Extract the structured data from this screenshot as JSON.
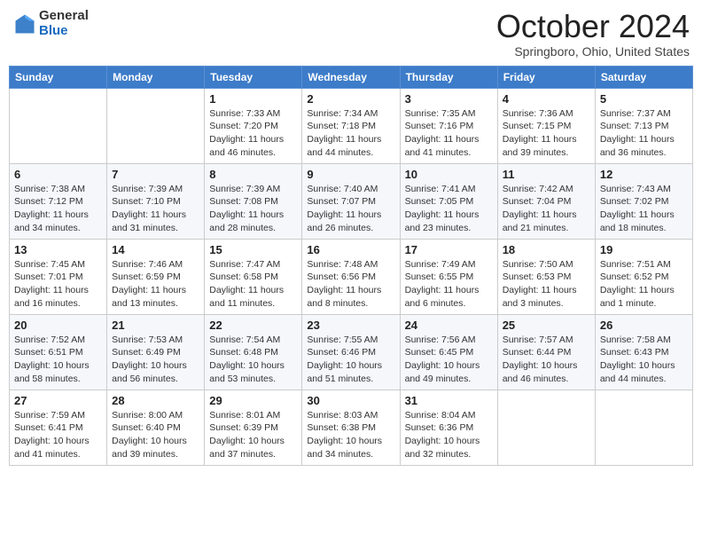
{
  "header": {
    "logo_general": "General",
    "logo_blue": "Blue",
    "month": "October 2024",
    "location": "Springboro, Ohio, United States"
  },
  "weekdays": [
    "Sunday",
    "Monday",
    "Tuesday",
    "Wednesday",
    "Thursday",
    "Friday",
    "Saturday"
  ],
  "weeks": [
    [
      {
        "day": null
      },
      {
        "day": null
      },
      {
        "day": "1",
        "sunrise": "Sunrise: 7:33 AM",
        "sunset": "Sunset: 7:20 PM",
        "daylight": "Daylight: 11 hours and 46 minutes."
      },
      {
        "day": "2",
        "sunrise": "Sunrise: 7:34 AM",
        "sunset": "Sunset: 7:18 PM",
        "daylight": "Daylight: 11 hours and 44 minutes."
      },
      {
        "day": "3",
        "sunrise": "Sunrise: 7:35 AM",
        "sunset": "Sunset: 7:16 PM",
        "daylight": "Daylight: 11 hours and 41 minutes."
      },
      {
        "day": "4",
        "sunrise": "Sunrise: 7:36 AM",
        "sunset": "Sunset: 7:15 PM",
        "daylight": "Daylight: 11 hours and 39 minutes."
      },
      {
        "day": "5",
        "sunrise": "Sunrise: 7:37 AM",
        "sunset": "Sunset: 7:13 PM",
        "daylight": "Daylight: 11 hours and 36 minutes."
      }
    ],
    [
      {
        "day": "6",
        "sunrise": "Sunrise: 7:38 AM",
        "sunset": "Sunset: 7:12 PM",
        "daylight": "Daylight: 11 hours and 34 minutes."
      },
      {
        "day": "7",
        "sunrise": "Sunrise: 7:39 AM",
        "sunset": "Sunset: 7:10 PM",
        "daylight": "Daylight: 11 hours and 31 minutes."
      },
      {
        "day": "8",
        "sunrise": "Sunrise: 7:39 AM",
        "sunset": "Sunset: 7:08 PM",
        "daylight": "Daylight: 11 hours and 28 minutes."
      },
      {
        "day": "9",
        "sunrise": "Sunrise: 7:40 AM",
        "sunset": "Sunset: 7:07 PM",
        "daylight": "Daylight: 11 hours and 26 minutes."
      },
      {
        "day": "10",
        "sunrise": "Sunrise: 7:41 AM",
        "sunset": "Sunset: 7:05 PM",
        "daylight": "Daylight: 11 hours and 23 minutes."
      },
      {
        "day": "11",
        "sunrise": "Sunrise: 7:42 AM",
        "sunset": "Sunset: 7:04 PM",
        "daylight": "Daylight: 11 hours and 21 minutes."
      },
      {
        "day": "12",
        "sunrise": "Sunrise: 7:43 AM",
        "sunset": "Sunset: 7:02 PM",
        "daylight": "Daylight: 11 hours and 18 minutes."
      }
    ],
    [
      {
        "day": "13",
        "sunrise": "Sunrise: 7:45 AM",
        "sunset": "Sunset: 7:01 PM",
        "daylight": "Daylight: 11 hours and 16 minutes."
      },
      {
        "day": "14",
        "sunrise": "Sunrise: 7:46 AM",
        "sunset": "Sunset: 6:59 PM",
        "daylight": "Daylight: 11 hours and 13 minutes."
      },
      {
        "day": "15",
        "sunrise": "Sunrise: 7:47 AM",
        "sunset": "Sunset: 6:58 PM",
        "daylight": "Daylight: 11 hours and 11 minutes."
      },
      {
        "day": "16",
        "sunrise": "Sunrise: 7:48 AM",
        "sunset": "Sunset: 6:56 PM",
        "daylight": "Daylight: 11 hours and 8 minutes."
      },
      {
        "day": "17",
        "sunrise": "Sunrise: 7:49 AM",
        "sunset": "Sunset: 6:55 PM",
        "daylight": "Daylight: 11 hours and 6 minutes."
      },
      {
        "day": "18",
        "sunrise": "Sunrise: 7:50 AM",
        "sunset": "Sunset: 6:53 PM",
        "daylight": "Daylight: 11 hours and 3 minutes."
      },
      {
        "day": "19",
        "sunrise": "Sunrise: 7:51 AM",
        "sunset": "Sunset: 6:52 PM",
        "daylight": "Daylight: 11 hours and 1 minute."
      }
    ],
    [
      {
        "day": "20",
        "sunrise": "Sunrise: 7:52 AM",
        "sunset": "Sunset: 6:51 PM",
        "daylight": "Daylight: 10 hours and 58 minutes."
      },
      {
        "day": "21",
        "sunrise": "Sunrise: 7:53 AM",
        "sunset": "Sunset: 6:49 PM",
        "daylight": "Daylight: 10 hours and 56 minutes."
      },
      {
        "day": "22",
        "sunrise": "Sunrise: 7:54 AM",
        "sunset": "Sunset: 6:48 PM",
        "daylight": "Daylight: 10 hours and 53 minutes."
      },
      {
        "day": "23",
        "sunrise": "Sunrise: 7:55 AM",
        "sunset": "Sunset: 6:46 PM",
        "daylight": "Daylight: 10 hours and 51 minutes."
      },
      {
        "day": "24",
        "sunrise": "Sunrise: 7:56 AM",
        "sunset": "Sunset: 6:45 PM",
        "daylight": "Daylight: 10 hours and 49 minutes."
      },
      {
        "day": "25",
        "sunrise": "Sunrise: 7:57 AM",
        "sunset": "Sunset: 6:44 PM",
        "daylight": "Daylight: 10 hours and 46 minutes."
      },
      {
        "day": "26",
        "sunrise": "Sunrise: 7:58 AM",
        "sunset": "Sunset: 6:43 PM",
        "daylight": "Daylight: 10 hours and 44 minutes."
      }
    ],
    [
      {
        "day": "27",
        "sunrise": "Sunrise: 7:59 AM",
        "sunset": "Sunset: 6:41 PM",
        "daylight": "Daylight: 10 hours and 41 minutes."
      },
      {
        "day": "28",
        "sunrise": "Sunrise: 8:00 AM",
        "sunset": "Sunset: 6:40 PM",
        "daylight": "Daylight: 10 hours and 39 minutes."
      },
      {
        "day": "29",
        "sunrise": "Sunrise: 8:01 AM",
        "sunset": "Sunset: 6:39 PM",
        "daylight": "Daylight: 10 hours and 37 minutes."
      },
      {
        "day": "30",
        "sunrise": "Sunrise: 8:03 AM",
        "sunset": "Sunset: 6:38 PM",
        "daylight": "Daylight: 10 hours and 34 minutes."
      },
      {
        "day": "31",
        "sunrise": "Sunrise: 8:04 AM",
        "sunset": "Sunset: 6:36 PM",
        "daylight": "Daylight: 10 hours and 32 minutes."
      },
      {
        "day": null
      },
      {
        "day": null
      }
    ]
  ]
}
